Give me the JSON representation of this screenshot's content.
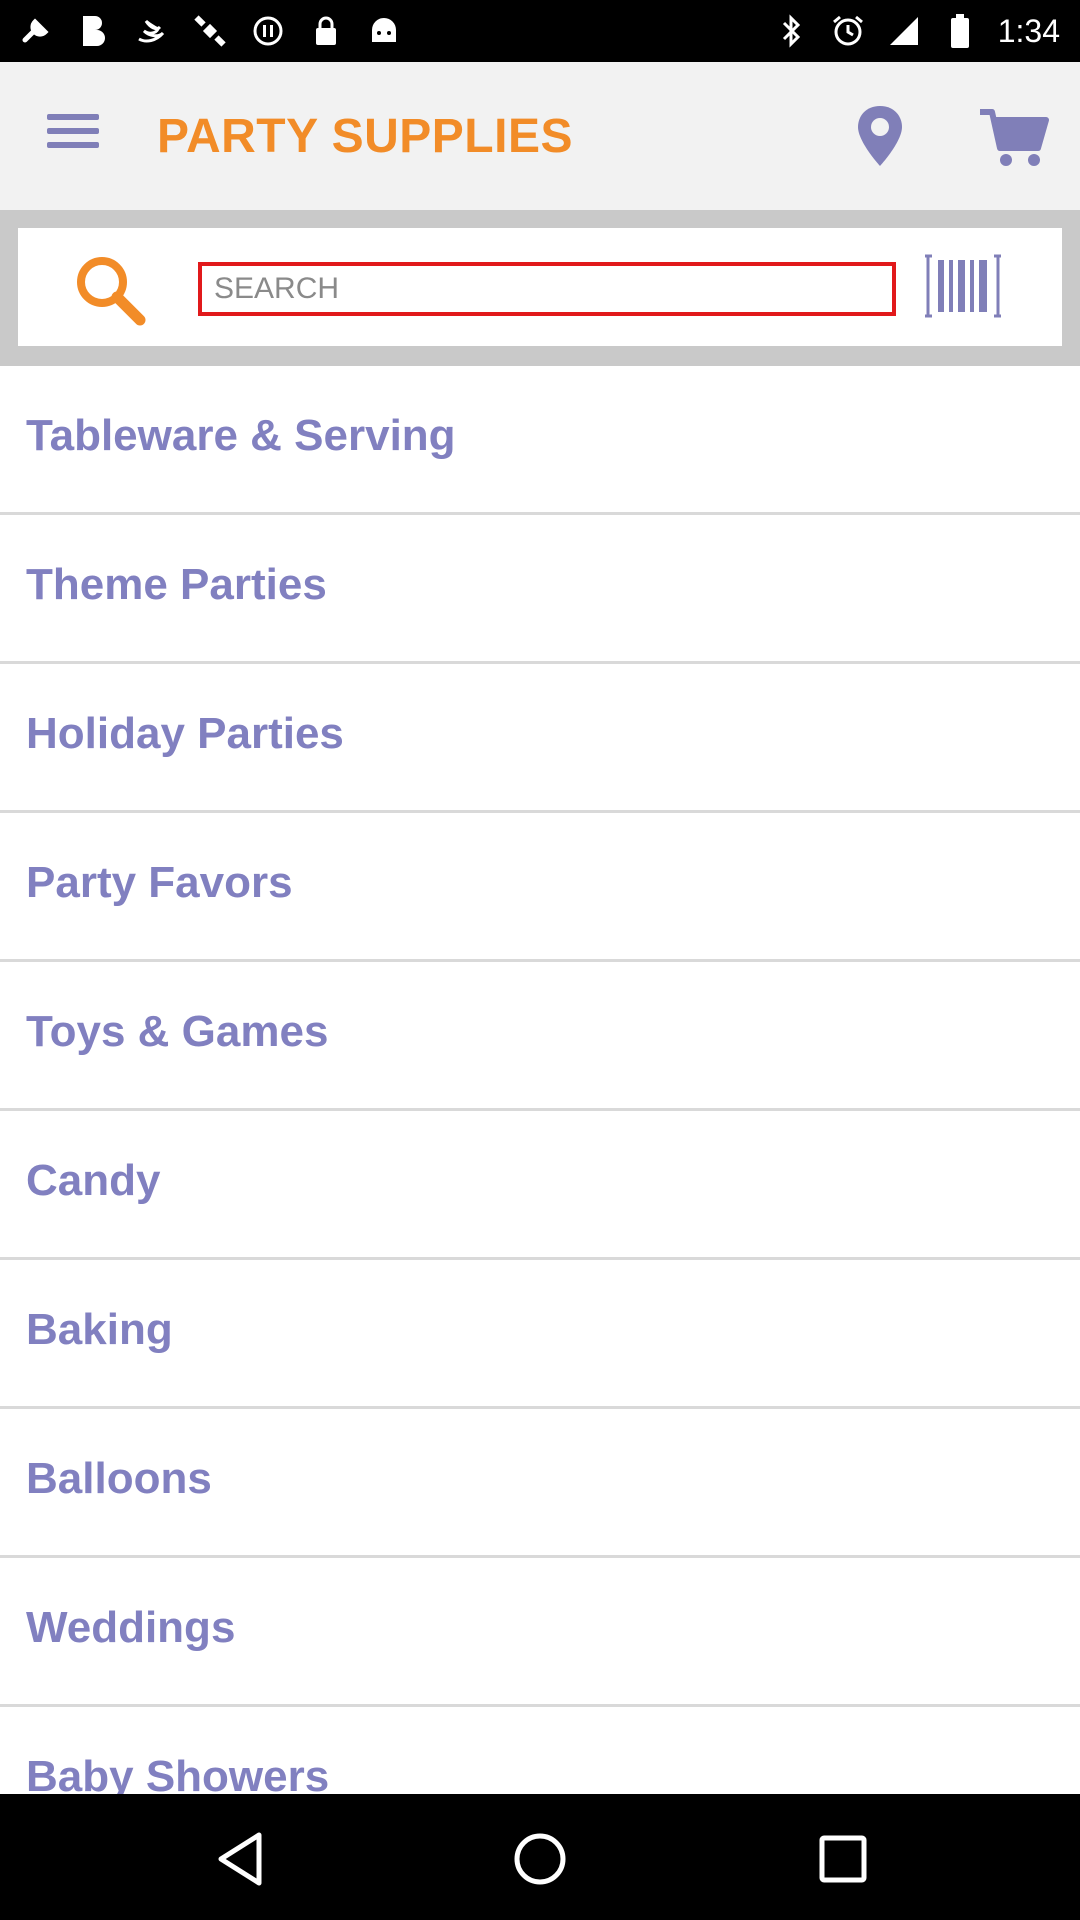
{
  "status_bar": {
    "time": "1:34",
    "left_icons": [
      "wrench-icon",
      "bold-b-icon",
      "swift-icon",
      "satellite-icon",
      "pause-circle-icon",
      "lock-icon",
      "android-icon"
    ],
    "right_icons": [
      "bluetooth-icon",
      "alarm-icon",
      "signal-icon",
      "battery-icon"
    ]
  },
  "app_bar": {
    "title": "PARTY SUPPLIES",
    "icons": {
      "menu": "menu-icon",
      "location": "location-pin-icon",
      "cart": "shopping-cart-icon"
    }
  },
  "search": {
    "placeholder": "SEARCH",
    "value": "",
    "icons": {
      "search": "search-icon",
      "barcode": "barcode-icon"
    }
  },
  "categories": [
    {
      "label": "Tableware & Serving"
    },
    {
      "label": "Theme Parties"
    },
    {
      "label": "Holiday Parties"
    },
    {
      "label": "Party Favors"
    },
    {
      "label": "Toys & Games"
    },
    {
      "label": "Candy"
    },
    {
      "label": "Baking"
    },
    {
      "label": "Balloons"
    },
    {
      "label": "Weddings"
    },
    {
      "label": "Baby Showers"
    }
  ],
  "colors": {
    "accent_orange": "#f28c28",
    "category_text": "#8180c0",
    "search_border": "#e1191b",
    "app_bar_bg": "#f2f2f2"
  },
  "nav_bar": {
    "icons": [
      "back-icon",
      "home-icon",
      "recents-icon"
    ]
  }
}
